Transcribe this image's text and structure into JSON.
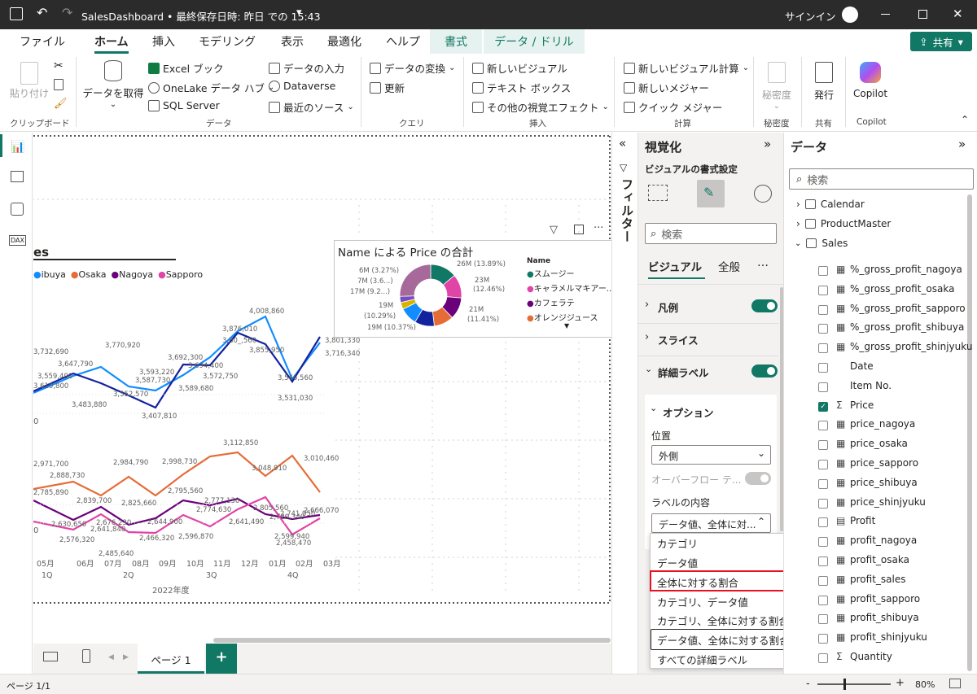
{
  "titlebar": {
    "title": "SalesDashboard • 最終保存日時: 昨日 での 15:43",
    "chevron": "▾",
    "signin": "サインイン",
    "icons": [
      "save-icon",
      "undo-icon",
      "redo-icon",
      "avatar-icon",
      "minimize-icon",
      "maximize-icon",
      "close-icon"
    ]
  },
  "tabs": [
    "ファイル",
    "ホーム",
    "挿入",
    "モデリング",
    "表示",
    "最適化",
    "ヘルプ",
    "書式",
    "データ / ドリル"
  ],
  "share_label": "共有",
  "ribbon": {
    "paste": "貼り付け",
    "get_data": "データを取得",
    "excel": "Excel ブック",
    "onelake": "OneLake データ ハブ",
    "sql": "SQL Server",
    "enter_data": "データの入力",
    "dataverse": "Dataverse",
    "recent": "最近のソース",
    "transform": "データの変換",
    "refresh": "更新",
    "new_visual": "新しいビジュアル",
    "textbox": "テキスト ボックス",
    "more_visuals": "その他の視覚エフェクト",
    "new_calc": "新しいビジュアル計算",
    "new_measure": "新しいメジャー",
    "quick_measure": "クイック メジャー",
    "sensitivity": "秘密度",
    "publish": "発行",
    "copilot": "Copilot",
    "groups": [
      "クリップボード",
      "データ",
      "クエリ",
      "挿入",
      "計算",
      "秘密度",
      "共有",
      "Copilot"
    ]
  },
  "canvas": {
    "partial_title": "es",
    "legend": [
      {
        "label": "ibuya",
        "color": "#118DFF"
      },
      {
        "label": "Osaka",
        "color": "#E66C37"
      },
      {
        "label": "Nagoya",
        "color": "#6B007B"
      },
      {
        "label": "Sapporo",
        "color": "#E044A7"
      }
    ],
    "x_months": [
      "05月",
      "06月",
      "07月",
      "08月",
      "09月",
      "10月",
      "11月",
      "12月",
      "01月",
      "02月",
      "03月"
    ],
    "x_quarters": [
      "1Q",
      "2Q",
      "3Q",
      "4Q"
    ],
    "x_year": "2022年度",
    "upper_labels": [
      "4,008,860",
      "3,876,010",
      "3,80_,560",
      "3,855,950",
      "3,801,330",
      "3,716,340",
      "3,770,920",
      "3,732,690",
      "3,647,790",
      "3,559,490",
      "3,692,300",
      "3,694,400",
      "3,593,220",
      "3,587,730",
      "3,572,750",
      "3,610,800",
      "3,552,570",
      "3,483,880",
      "3,589,680",
      "3,566,560",
      "3,531,030",
      "3,407,810"
    ],
    "lower_labels": [
      "3,112,850",
      "3,048,910",
      "3,010,460",
      "2,971,700",
      "2,984,790",
      "2,998,730",
      "2,888,730",
      "2,839,700",
      "2,825,660",
      "2,795,560",
      "2,785,890",
      "2,777,130",
      "2,774,630",
      "2,805,560",
      "2,741,950",
      "2,729,340",
      "2,666,070",
      "2,676,230",
      "2,644,900",
      "2,641,490",
      "2,641,840",
      "2,630,650",
      "2,599,940",
      "2,596,870",
      "2,576,320",
      "2,466,320",
      "2,485,640",
      "2,458,470"
    ],
    "axis_fragment_1": "0",
    "axis_fragment_2": "0"
  },
  "donut": {
    "title": "Name による Price の合計",
    "legend_title": "Name",
    "legend": [
      {
        "label": "スムージー",
        "color": "#117865"
      },
      {
        "label": "キャラメルマキアー...",
        "color": "#E044A7"
      },
      {
        "label": "カフェラテ",
        "color": "#6B007B"
      },
      {
        "label": "オレンジジュース",
        "color": "#E66C37"
      }
    ],
    "labels_left": [
      "6M (3.27%)",
      "7M (3.6...)",
      "17M (9.2...)",
      "19M",
      "(10.29%)",
      "19M (10.37%)"
    ],
    "labels_right": [
      "26M (13.89%)",
      "23M",
      "(12.46%)",
      "21M",
      "(11.41%)"
    ]
  },
  "chart_data": {
    "type": "pie",
    "title": "Name による Price の合計",
    "series": [
      {
        "name": "スムージー",
        "value": 26,
        "percent": 13.89,
        "color": "#117865"
      },
      {
        "name": "キャラメルマキアー...",
        "value": 23,
        "percent": 12.46,
        "color": "#E044A7"
      },
      {
        "name": "カフェラテ",
        "value": 21,
        "percent": 11.41,
        "color": "#6B007B"
      },
      {
        "name": "オレンジジュース",
        "value": 19,
        "percent": 10.37,
        "color": "#E66C37"
      },
      {
        "value": 19,
        "percent": 10.29,
        "color": "#12239E"
      },
      {
        "value": 17,
        "percent": 9.2,
        "color": "#118DFF"
      },
      {
        "value": 7,
        "percent": 3.6,
        "color": "#D9B300"
      },
      {
        "value": 6,
        "percent": 3.27,
        "color": "#744EC2"
      }
    ]
  },
  "filter_label": "フィルター",
  "viz": {
    "title": "視覚化",
    "subtitle": "ビジュアルの書式設定",
    "search_placeholder": "検索",
    "tab_visual": "ビジュアル",
    "tab_general": "全般",
    "more": "…",
    "legend": "凡例",
    "slice": "スライス",
    "detail_labels": "詳細ラベル",
    "options": "オプション",
    "position_label": "位置",
    "position_value": "外側",
    "overflow": "オーバーフロー テ...",
    "label_content": "ラベルの内容",
    "label_content_value": "データ値、全体に対...",
    "dropdown_items": [
      "カテゴリ",
      "データ値",
      "全体に対する割合",
      "カテゴリ、データ値",
      "カテゴリ、全体に対する割合",
      "データ値、全体に対する割合",
      "すべての詳細ラベル"
    ]
  },
  "data": {
    "title": "データ",
    "search_placeholder": "検索",
    "tables": [
      "Calendar",
      "ProductMaster",
      "Sales"
    ],
    "fields": [
      {
        "name": "%_gross_profit_nagoya",
        "type": "calc",
        "checked": false
      },
      {
        "name": "%_gross_profit_osaka",
        "type": "calc",
        "checked": false
      },
      {
        "name": "%_gross_profit_sapporo",
        "type": "calc",
        "checked": false
      },
      {
        "name": "%_gross_profit_shibuya",
        "type": "calc",
        "checked": false
      },
      {
        "name": "%_gross_profit_shinjyuku",
        "type": "calc",
        "checked": false
      },
      {
        "name": "Date",
        "type": "none",
        "checked": false
      },
      {
        "name": "Item No.",
        "type": "none",
        "checked": false
      },
      {
        "name": "Price",
        "type": "sum",
        "checked": true
      },
      {
        "name": "price_nagoya",
        "type": "calc",
        "checked": false
      },
      {
        "name": "price_osaka",
        "type": "calc",
        "checked": false
      },
      {
        "name": "price_sapporo",
        "type": "calc",
        "checked": false
      },
      {
        "name": "price_shibuya",
        "type": "calc",
        "checked": false
      },
      {
        "name": "price_shinjyuku",
        "type": "calc",
        "checked": false
      },
      {
        "name": "Profit",
        "type": "table",
        "checked": false
      },
      {
        "name": "profit_nagoya",
        "type": "calc",
        "checked": false
      },
      {
        "name": "profit_osaka",
        "type": "calc",
        "checked": false
      },
      {
        "name": "profit_sales",
        "type": "calc",
        "checked": false
      },
      {
        "name": "profit_sapporo",
        "type": "calc",
        "checked": false
      },
      {
        "name": "profit_shibuya",
        "type": "calc",
        "checked": false
      },
      {
        "name": "profit_shinjyuku",
        "type": "calc",
        "checked": false
      },
      {
        "name": "Quantity",
        "type": "sum",
        "checked": false
      }
    ]
  },
  "pages": {
    "page1": "ページ 1",
    "add": "+"
  },
  "status": {
    "page": "ページ 1/1",
    "zoom": "80%",
    "minus": "-",
    "plus": "+"
  }
}
